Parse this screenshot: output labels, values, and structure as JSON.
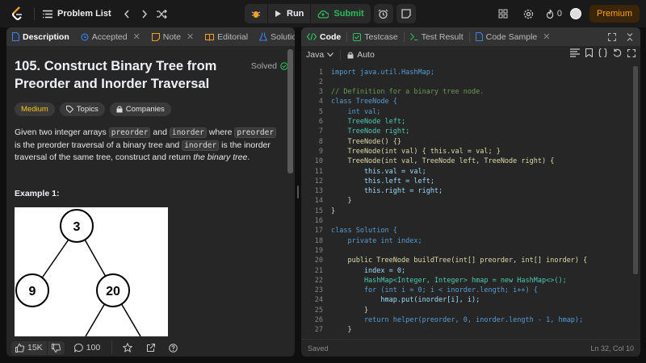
{
  "nav": {
    "problem_list": "Problem List",
    "run": "Run",
    "submit": "Submit",
    "streak_count": "0",
    "premium": "Premium"
  },
  "left_tabs": [
    {
      "label": "Description"
    },
    {
      "label": "Accepted"
    },
    {
      "label": "Note"
    },
    {
      "label": "Editorial"
    },
    {
      "label": "Solutions"
    }
  ],
  "problem": {
    "title": "105. Construct Binary Tree from Preorder and Inorder Traversal",
    "status": "Solved",
    "difficulty": "Medium",
    "topics_label": "Topics",
    "companies_label": "Companies",
    "desc_parts": {
      "p1": "Given two integer arrays ",
      "c1": "preorder",
      "p2": " and ",
      "c2": "inorder",
      "p3": " where ",
      "c3": "preorder",
      "p4": " is the preorder traversal of a binary tree and ",
      "c4": "inorder",
      "p5": " is the inorder traversal of the same tree, construct and return ",
      "em": "the binary tree",
      "p6": "."
    },
    "example_label": "Example 1:",
    "tree_nodes": [
      "3",
      "9",
      "20"
    ]
  },
  "footer": {
    "likes": "15K",
    "comments": "100"
  },
  "right_tabs": [
    {
      "label": "Code"
    },
    {
      "label": "Testcase"
    },
    {
      "label": "Test Result"
    },
    {
      "label": "Code Sample"
    }
  ],
  "editor": {
    "language": "Java",
    "mode": "Auto",
    "lines": [
      "import java.util.HashMap;",
      "",
      "// Definition for a binary tree node.",
      "class TreeNode {",
      "    int val;",
      "    TreeNode left;",
      "    TreeNode right;",
      "    TreeNode() {}",
      "    TreeNode(int val) { this.val = val; }",
      "    TreeNode(int val, TreeNode left, TreeNode right) {",
      "        this.val = val;",
      "        this.left = left;",
      "        this.right = right;",
      "    }",
      "}",
      "",
      "class Solution {",
      "    private int index;",
      "",
      "    public TreeNode buildTree(int[] preorder, int[] inorder) {",
      "        index = 0;",
      "        HashMap<Integer, Integer> hmap = new HashMap<>();",
      "        for (int i = 0; i < inorder.length; i++) {",
      "            hmap.put(inorder[i], i);",
      "        }",
      "        return helper(preorder, 0, inorder.length - 1, hmap);",
      "    }"
    ],
    "status_left": "Saved",
    "status_right": "Ln 32, Col 10"
  },
  "colors": {
    "accent": "#ffa116",
    "success": "#2cbb5d",
    "medium": "#ffc01e"
  }
}
